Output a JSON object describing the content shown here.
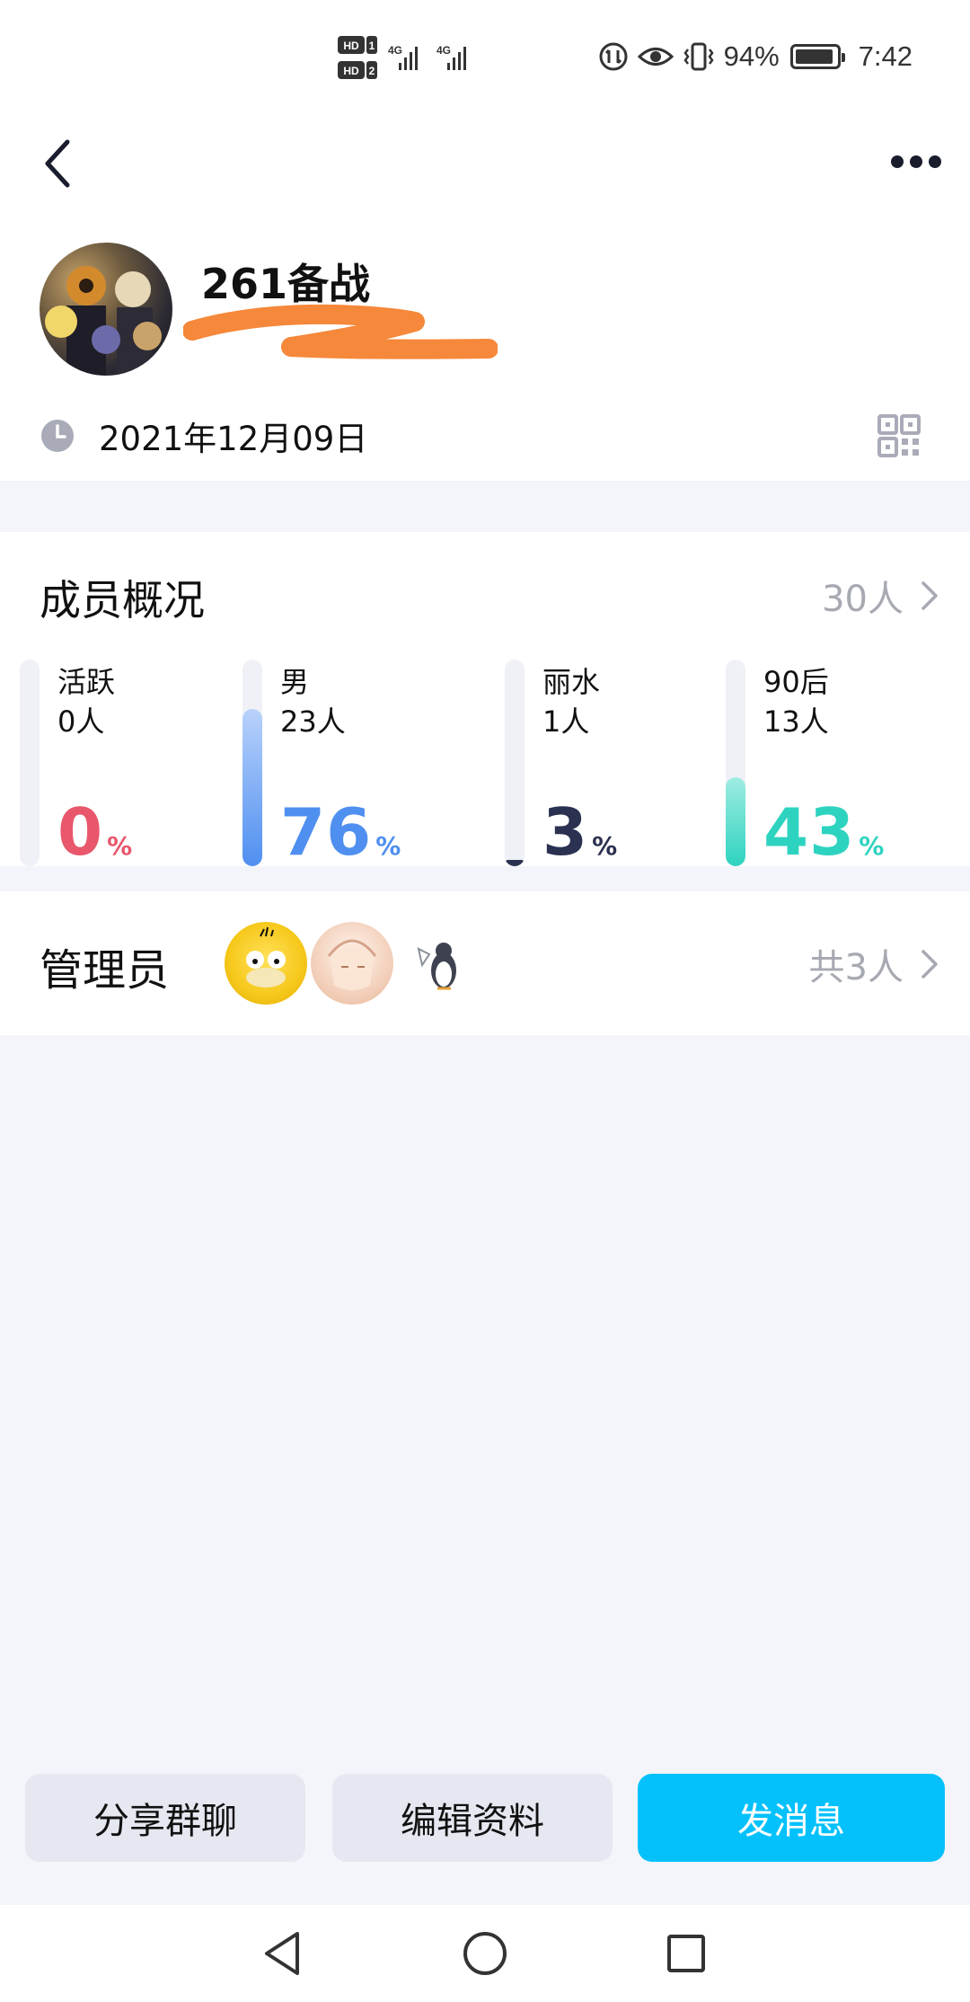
{
  "status_bar": {
    "network_1": "4G",
    "network_2": "4G",
    "battery": "94%",
    "battery_level": 0.94,
    "time": "7:42"
  },
  "header": {
    "group_name": "261备战",
    "created_date": "2021年12月09日"
  },
  "members": {
    "title": "成员概况",
    "total": "30人",
    "stats": [
      {
        "label": "活跃",
        "count": "0人",
        "percent": "0",
        "unit": "%",
        "fraction": 0.0,
        "color": "#e8576b"
      },
      {
        "label": "男",
        "count": "23人",
        "percent": "76",
        "unit": "%",
        "fraction": 0.76,
        "color": "#4f8ff0"
      },
      {
        "label": "丽水",
        "count": "1人",
        "percent": "3",
        "unit": "%",
        "fraction": 0.03,
        "color": "#2b3150"
      },
      {
        "label": "90后",
        "count": "13人",
        "percent": "43",
        "unit": "%",
        "fraction": 0.43,
        "color": "#2ed3c0"
      }
    ]
  },
  "admins": {
    "title": "管理员",
    "total": "共3人"
  },
  "actions": {
    "share": "分享群聊",
    "edit": "编辑资料",
    "send": "发消息"
  },
  "colors": {
    "accent": "#05c1fb",
    "background": "#f3f5fa",
    "redaction": "#f5883a"
  }
}
